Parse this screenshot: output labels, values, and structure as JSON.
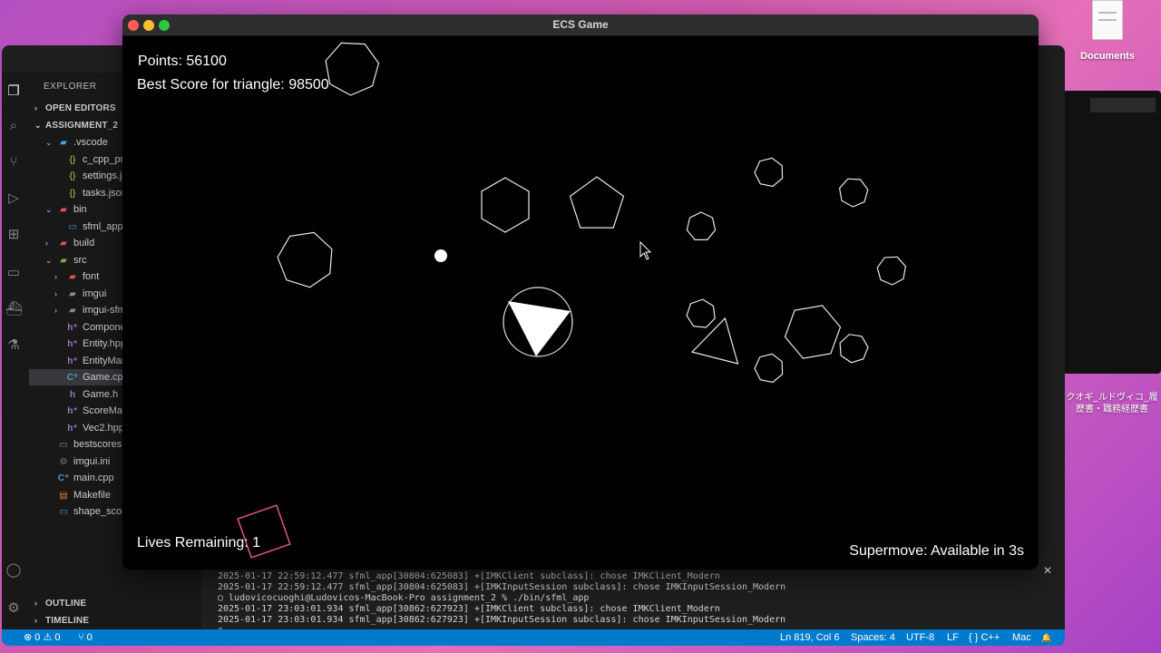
{
  "desktop": {
    "documents_label": "Documents",
    "jp_line1": "クオギ_ルドヴィコ_履",
    "jp_line2": "歴書・職務経歴書"
  },
  "game_window": {
    "title": "ECS Game",
    "points": "Points: 56100",
    "best_score": "Best Score for triangle: 98500",
    "lives": "Lives Remaining: 1",
    "supermove": "Supermove: Available in 3s"
  },
  "vscode": {
    "explorer_title": "EXPLORER",
    "sections": {
      "open_editors": "OPEN EDITORS",
      "project": "ASSIGNMENT_2",
      "outline": "OUTLINE",
      "timeline": "TIMELINE"
    },
    "tree": [
      {
        "label": ".vscode",
        "chev": "⌄",
        "icon": "▰",
        "icon_class": "folder-blue",
        "indent": 1
      },
      {
        "label": "c_cpp_properties.json",
        "chev": "",
        "icon": "{}",
        "icon_class": "json",
        "indent": 2
      },
      {
        "label": "settings.json",
        "chev": "",
        "icon": "{}",
        "icon_class": "json",
        "indent": 2
      },
      {
        "label": "tasks.json",
        "chev": "",
        "icon": "{}",
        "icon_class": "json",
        "indent": 2
      },
      {
        "label": "bin",
        "chev": "⌄",
        "icon": "▰",
        "icon_class": "folder-red",
        "indent": 1
      },
      {
        "label": "sfml_app",
        "chev": "",
        "icon": "▭",
        "icon_class": "file",
        "indent": 2
      },
      {
        "label": "build",
        "chev": "›",
        "icon": "▰",
        "icon_class": "folder-red",
        "indent": 1
      },
      {
        "label": "src",
        "chev": "⌄",
        "icon": "▰",
        "icon_class": "folder-green",
        "indent": 1
      },
      {
        "label": "font",
        "chev": "›",
        "icon": "▰",
        "icon_class": "folder-red",
        "indent": 2
      },
      {
        "label": "imgui",
        "chev": "›",
        "icon": "▰",
        "icon_class": "folder",
        "indent": 2
      },
      {
        "label": "imgui-sfml",
        "chev": "›",
        "icon": "▰",
        "icon_class": "folder",
        "indent": 2
      },
      {
        "label": "Components.hpp",
        "chev": "",
        "icon": "h⁺",
        "icon_class": "hpp",
        "indent": 2
      },
      {
        "label": "Entity.hpp",
        "chev": "",
        "icon": "h⁺",
        "icon_class": "hpp",
        "indent": 2
      },
      {
        "label": "EntityManager.hpp",
        "chev": "",
        "icon": "h⁺",
        "icon_class": "hpp",
        "indent": 2
      },
      {
        "label": "Game.cpp",
        "chev": "",
        "icon": "C⁺",
        "icon_class": "cpp",
        "indent": 2,
        "selected": true
      },
      {
        "label": "Game.h",
        "chev": "",
        "icon": "h",
        "icon_class": "hpp",
        "indent": 2
      },
      {
        "label": "ScoreManager.hpp",
        "chev": "",
        "icon": "h⁺",
        "icon_class": "hpp",
        "indent": 2
      },
      {
        "label": "Vec2.hpp",
        "chev": "",
        "icon": "h⁺",
        "icon_class": "hpp",
        "indent": 2
      },
      {
        "label": "bestscores",
        "chev": "",
        "icon": "▭",
        "icon_class": "file",
        "indent": 1
      },
      {
        "label": "imgui.ini",
        "chev": "",
        "icon": "⚙",
        "icon_class": "gear",
        "indent": 1
      },
      {
        "label": "main.cpp",
        "chev": "",
        "icon": "C⁺",
        "icon_class": "cpp",
        "indent": 1
      },
      {
        "label": "Makefile",
        "chev": "",
        "icon": "▤",
        "icon_class": "make",
        "indent": 1
      },
      {
        "label": "shape_scores",
        "chev": "",
        "icon": "▭",
        "icon_class": "file",
        "indent": 1
      }
    ],
    "terminal_lines": [
      "2025-01-17 22:59:12.477 sfml_app[30804:625083] +[IMKClient subclass]: chose IMKClient_Modern",
      "2025-01-17 22:59:12.477 sfml_app[30804:625083] +[IMKInputSession subclass]: chose IMKInputSession_Modern",
      "○ ludovicocuoghi@Ludovicos-MacBook-Pro assignment_2 % ./bin/sfml_app",
      "2025-01-17 23:03:01.934 sfml_app[30862:627923] +[IMKClient subclass]: chose IMKClient_Modern",
      "2025-01-17 23:03:01.934 sfml_app[30862:627923] +[IMKInputSession subclass]: chose IMKInputSession_Modern",
      "▯"
    ],
    "status": {
      "errors": "⊗ 0 ⚠ 0",
      "ports": "⑂ 0",
      "position": "Ln 819, Col 6",
      "spaces": "Spaces: 4",
      "encoding": "UTF-8",
      "eol": "LF",
      "language": "{ } C++",
      "platform": "Mac",
      "bell": "🔔"
    }
  },
  "colors": {
    "status_bar": "#007acc",
    "pink_square": "#e0559a",
    "shape_stroke": "#e8e8e8"
  },
  "entities": [
    {
      "kind": "heptagon",
      "name": "enemy-heptagon"
    },
    {
      "kind": "hexagon",
      "name": "enemy-hexagon"
    },
    {
      "kind": "pentagon",
      "name": "enemy-pentagon"
    },
    {
      "kind": "heptagon",
      "name": "enemy-heptagon"
    },
    {
      "kind": "small-heptagon",
      "name": "small-enemy"
    },
    {
      "kind": "small-heptagon",
      "name": "small-enemy"
    },
    {
      "kind": "small-heptagon",
      "name": "small-enemy"
    },
    {
      "kind": "small-heptagon",
      "name": "small-enemy"
    },
    {
      "kind": "small-heptagon",
      "name": "small-enemy"
    },
    {
      "kind": "hexagon",
      "name": "enemy-hexagon"
    },
    {
      "kind": "small-heptagon",
      "name": "small-enemy"
    },
    {
      "kind": "small-heptagon",
      "name": "small-enemy"
    },
    {
      "kind": "triangle",
      "name": "enemy-triangle"
    },
    {
      "kind": "square",
      "name": "enemy-square"
    },
    {
      "kind": "bullet",
      "name": "bullet"
    },
    {
      "kind": "player",
      "name": "player-triangle"
    }
  ]
}
